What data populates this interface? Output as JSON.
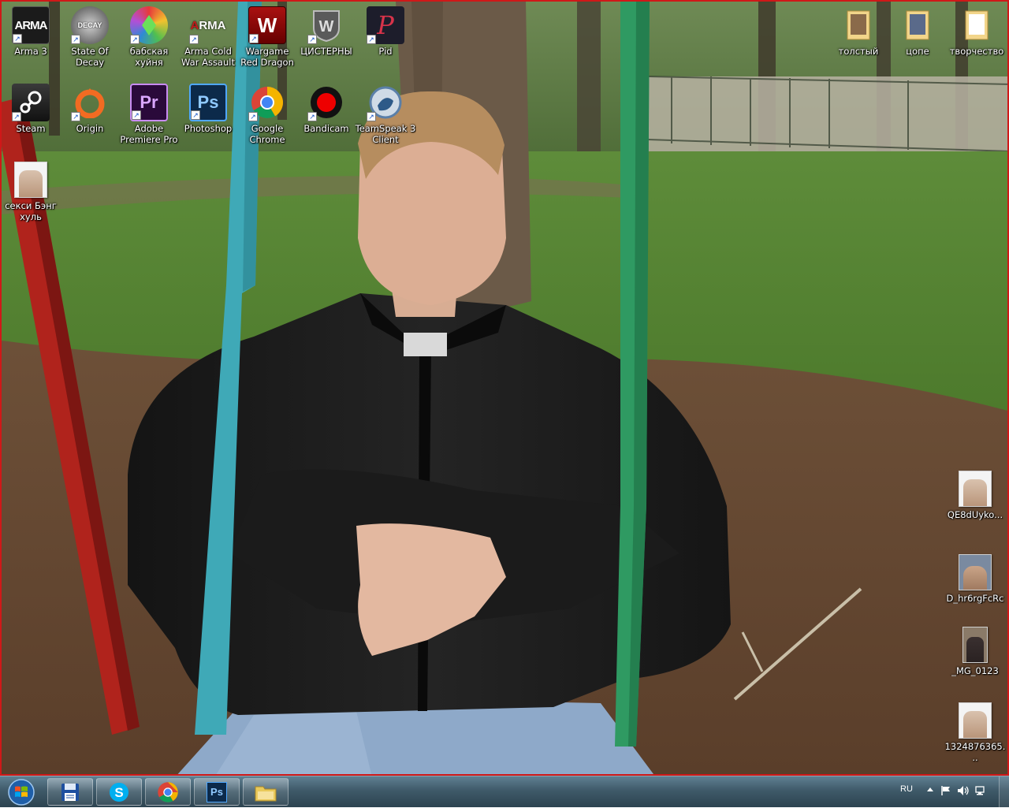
{
  "desktop": {
    "left_icons": [
      {
        "id": "arma3",
        "label": "Arma 3",
        "icon": "arma3-icon",
        "color": "#1b1b1b",
        "shortcut": true
      },
      {
        "id": "state-of-decay",
        "label": "State Of Decay",
        "icon": "state-of-decay-icon",
        "color": "#3a3a3a",
        "shortcut": true
      },
      {
        "id": "babskaya",
        "label": "бабская хуйня",
        "icon": "sims-plumbob-icon",
        "color": "#5fb34a",
        "shortcut": true
      },
      {
        "id": "arma-cold-war",
        "label": "Arma Cold War Assault",
        "icon": "arma-cold-war-icon",
        "color": "#c21a1a",
        "shortcut": true
      },
      {
        "id": "wargame",
        "label": "Wargame Red Dragon",
        "icon": "wargame-icon",
        "color": "#8a0f0f",
        "shortcut": true
      },
      {
        "id": "tanks",
        "label": "ЦИСТЕРНЫ",
        "icon": "world-of-tanks-icon",
        "color": "#3b3b3b",
        "shortcut": true
      },
      {
        "id": "pid",
        "label": "Pid",
        "icon": "pid-icon",
        "color": "#2a2a3a",
        "shortcut": true
      },
      {
        "id": "steam",
        "label": "Steam",
        "icon": "steam-icon",
        "color": "#1b2838",
        "shortcut": true
      },
      {
        "id": "origin",
        "label": "Origin",
        "icon": "origin-icon",
        "color": "#f26b22",
        "shortcut": true
      },
      {
        "id": "premiere",
        "label": "Adobe Premiere Pro",
        "icon": "premiere-pro-icon",
        "color": "#2a0a3a",
        "shortcut": true
      },
      {
        "id": "photoshop",
        "label": "Photoshop",
        "icon": "photoshop-icon",
        "color": "#0c2a4a",
        "shortcut": true
      },
      {
        "id": "chrome",
        "label": "Google Chrome",
        "icon": "chrome-icon",
        "color": "#4285f4",
        "shortcut": true
      },
      {
        "id": "bandicam",
        "label": "Bandicam",
        "icon": "bandicam-icon",
        "color": "#d40000",
        "shortcut": true
      },
      {
        "id": "teamspeak",
        "label": "TeamSpeak 3 Client",
        "icon": "teamspeak-icon",
        "color": "#5a7fa8",
        "shortcut": true
      },
      {
        "id": "sexy-bang",
        "label": "секси Бэнг хуль",
        "icon": "photo-file-icon",
        "color": "#e8d6c8",
        "shortcut": false
      }
    ],
    "right_folders": [
      {
        "id": "tolstyi",
        "label": "толстый",
        "icon": "folder-icon"
      },
      {
        "id": "tsope",
        "label": "цопе",
        "icon": "folder-icon"
      },
      {
        "id": "tvorchestvo",
        "label": "творчество",
        "icon": "folder-icon"
      }
    ],
    "right_files": [
      {
        "id": "qe8",
        "label": "QE8dUyko...",
        "icon": "photo-file-icon"
      },
      {
        "id": "dhr",
        "label": "D_hr6rgFcRc",
        "icon": "photo-file-icon"
      },
      {
        "id": "mg0123",
        "label": "_MG_0123",
        "icon": "photo-file-icon"
      },
      {
        "id": "n132",
        "label": "1324876365...",
        "icon": "photo-file-icon"
      }
    ]
  },
  "taskbar": {
    "buttons": [
      {
        "id": "save",
        "icon": "floppy-disk-icon"
      },
      {
        "id": "skype",
        "icon": "skype-icon"
      },
      {
        "id": "chrome",
        "icon": "chrome-icon"
      },
      {
        "id": "photoshop",
        "icon": "photoshop-icon"
      },
      {
        "id": "explorer",
        "icon": "explorer-folder-icon"
      }
    ],
    "tray": {
      "language": "RU"
    }
  },
  "colors": {
    "frame": "#d01818",
    "taskbar": "#3f5a69",
    "label_text": "#ffffff"
  }
}
